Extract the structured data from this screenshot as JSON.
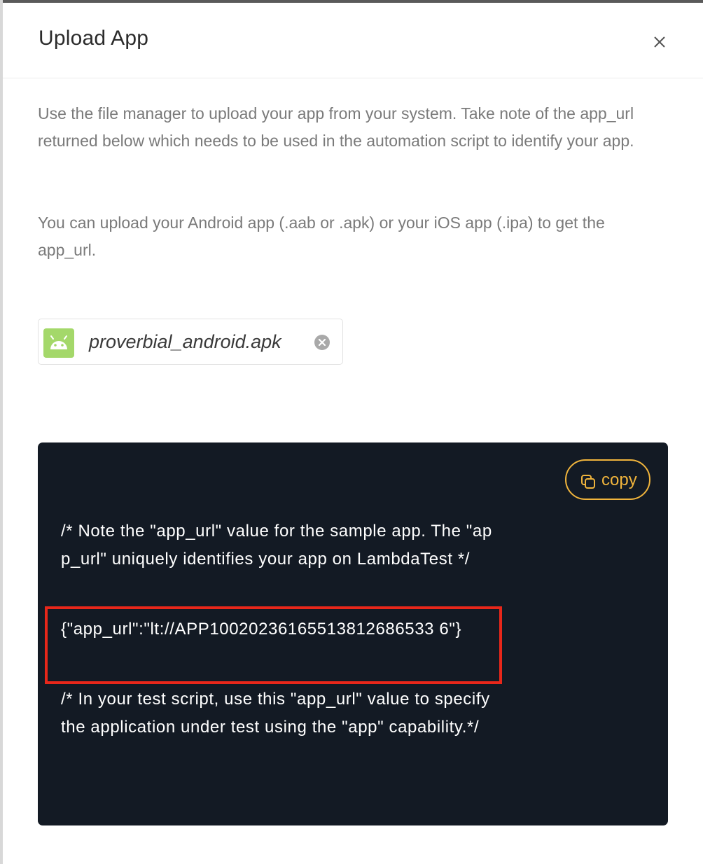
{
  "dialog": {
    "title": "Upload App",
    "close_icon": "close-icon"
  },
  "description": {
    "paragraph1": "Use the file manager to upload your app from your system. Take note of the app_url returned below which needs to be used in the automation script to identify your app.",
    "paragraph2": "You can upload your Android app (.aab or .apk) or your iOS app (.ipa) to get the app_url."
  },
  "uploaded_file": {
    "name": "proverbial_android.apk",
    "icon": "android-icon",
    "remove_icon": "remove-circle-icon"
  },
  "code_panel": {
    "copy_label": "copy",
    "copy_icon": "copy-icon",
    "comment1": "/* Note the \"app_url\" value for the sample app. The \"app_url\" uniquely identifies your app on LambdaTest */",
    "app_url_json": "{\"app_url\":\"lt://APP10020236165513812686533 6\"}",
    "comment2": "/* In your test script, use this \"app_url\" value to specify the application under test using the \"app\" capability.*/"
  },
  "colors": {
    "accent": "#f0b43c",
    "code_background": "#131a24",
    "highlight": "#e8271a",
    "android_green": "#a4d86a"
  }
}
